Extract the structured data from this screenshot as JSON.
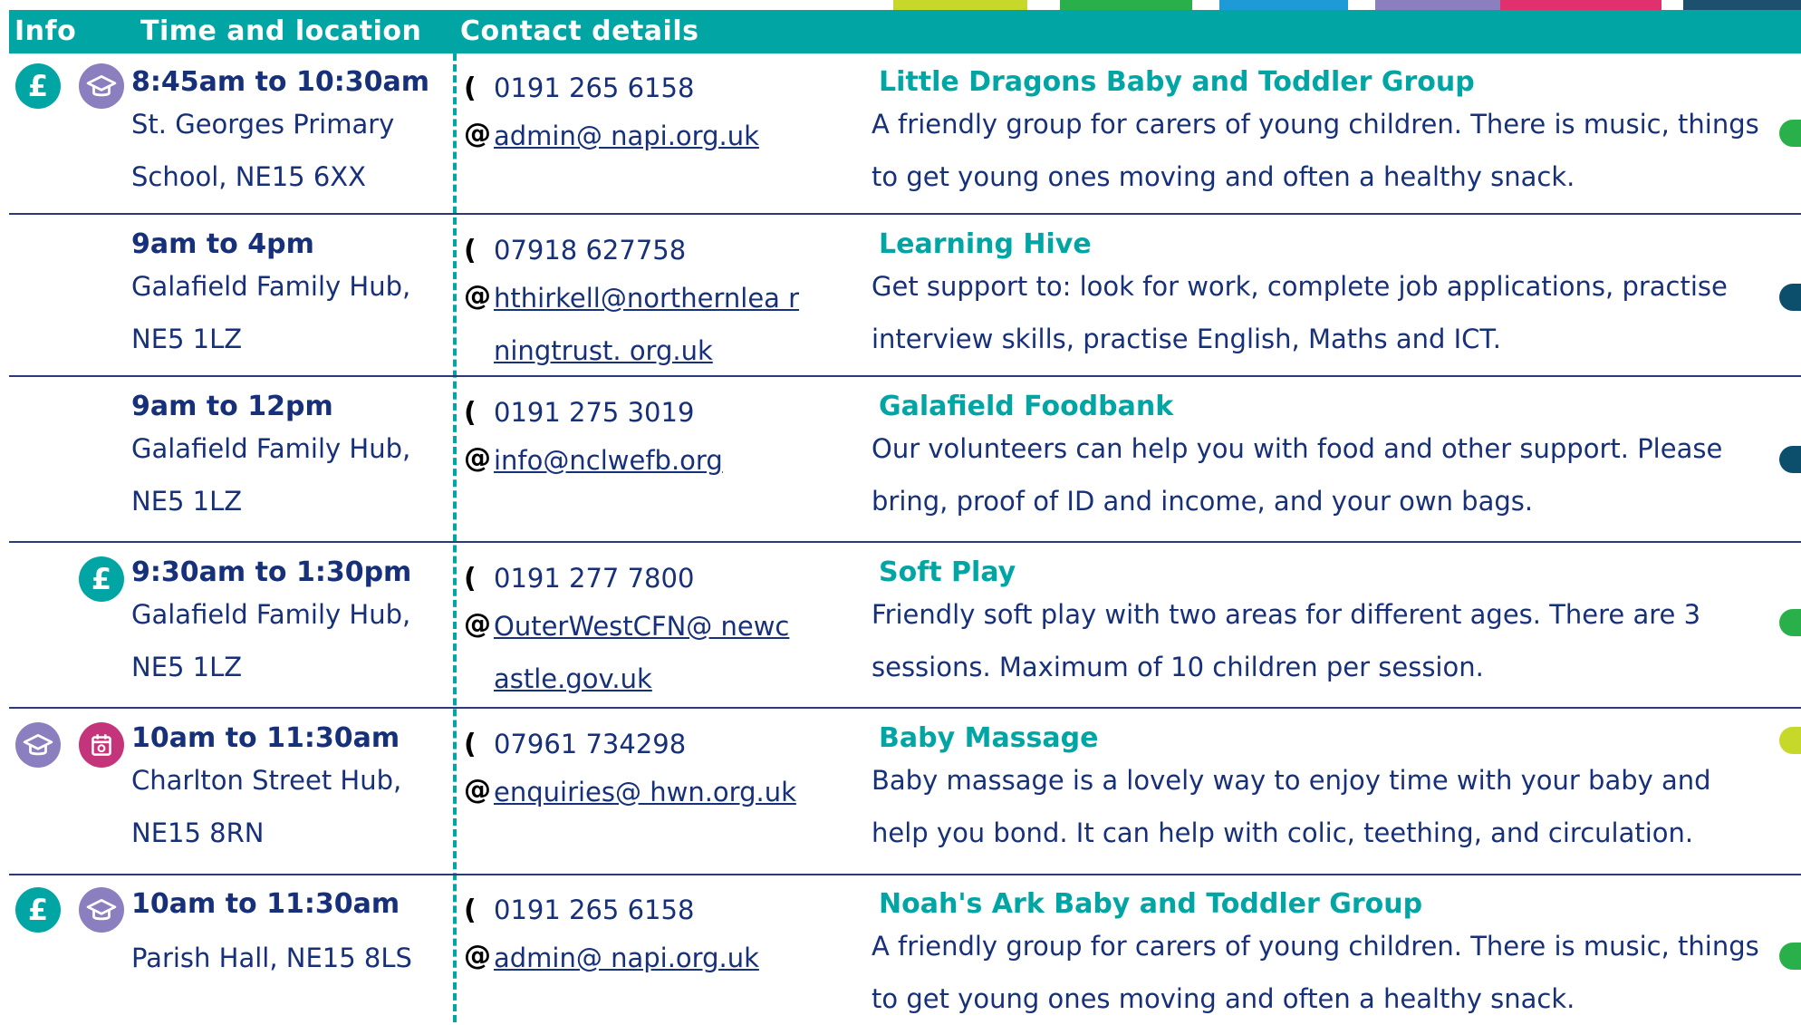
{
  "header": {
    "info": "Info",
    "time_location": "Time and location",
    "contact_details": "Contact details"
  },
  "colors": {
    "teal": "#00a5a4",
    "navy": "#17307a",
    "purple": "#8c7fbf",
    "magenta": "#c4347a",
    "green": "#2ab04a",
    "dark_blue": "#0b4f6c",
    "lime": "#c6d82a"
  },
  "rows": [
    {
      "icons": [
        "pound-icon",
        "graduation-cap-icon"
      ],
      "time": "8:45am to 10:30am",
      "location": "St. Georges Primary School, NE15 6XX",
      "phone": "0191 265 6158",
      "email": "admin@ napi.org.uk",
      "title": "Little Dragons Baby and Toddler Group",
      "description": "A friendly group for carers of young children. There is music, things to get young ones moving and often a healthy snack.",
      "dot_color": "#2ab04a"
    },
    {
      "icons": [],
      "time": "9am to 4pm",
      "location": "Galafield Family Hub, NE5 1LZ",
      "phone": "07918 627758",
      "email": "hthirkell@northernlea rningtrust. org.uk",
      "title": "Learning Hive",
      "description": "Get support to: look for work, complete job applications, practise interview skills, practise English, Maths and ICT.",
      "dot_color": "#0b4f6c"
    },
    {
      "icons": [],
      "time": "9am to 12pm",
      "location": "Galafield Family Hub, NE5 1LZ",
      "phone": "0191 275 3019",
      "email": "info@nclwefb.org",
      "title": "Galafield Foodbank",
      "description": "Our volunteers can help you with food and other support. Please bring, proof of ID and income, and your own bags.",
      "dot_color": "#0b4f6c"
    },
    {
      "icons": [
        "pound-icon"
      ],
      "time": "9:30am to 1:30pm",
      "location": "Galafield Family Hub, NE5 1LZ",
      "phone": "0191 277 7800",
      "email": "OuterWestCFN@ newcastle.gov.uk",
      "title": "Soft Play",
      "description": "Friendly soft play with two areas for different ages. There are 3 sessions. Maximum of 10 children per session.",
      "dot_color": "#2ab04a"
    },
    {
      "icons": [
        "graduation-cap-icon",
        "calendar-icon"
      ],
      "time": "10am to 11:30am",
      "location": "Charlton Street Hub, NE15 8RN",
      "phone": "07961 734298",
      "email": "enquiries@ hwn.org.uk",
      "title": "Baby Massage",
      "description": "Baby massage is a lovely way to enjoy time with your baby and help you bond. It can help with colic, teething, and circulation.",
      "dot_color": "#c6d82a"
    },
    {
      "icons": [
        "pound-icon",
        "graduation-cap-icon"
      ],
      "time": "10am to 11:30am",
      "location": "Parish Hall, NE15 8LS",
      "phone": "0191 265 6158",
      "email": "admin@ napi.org.uk",
      "title": "Noah's Ark Baby and Toddler Group",
      "description": "A friendly group for carers of young children. There is music, things to get young ones moving and often a healthy snack.",
      "dot_color": "#2ab04a"
    }
  ]
}
